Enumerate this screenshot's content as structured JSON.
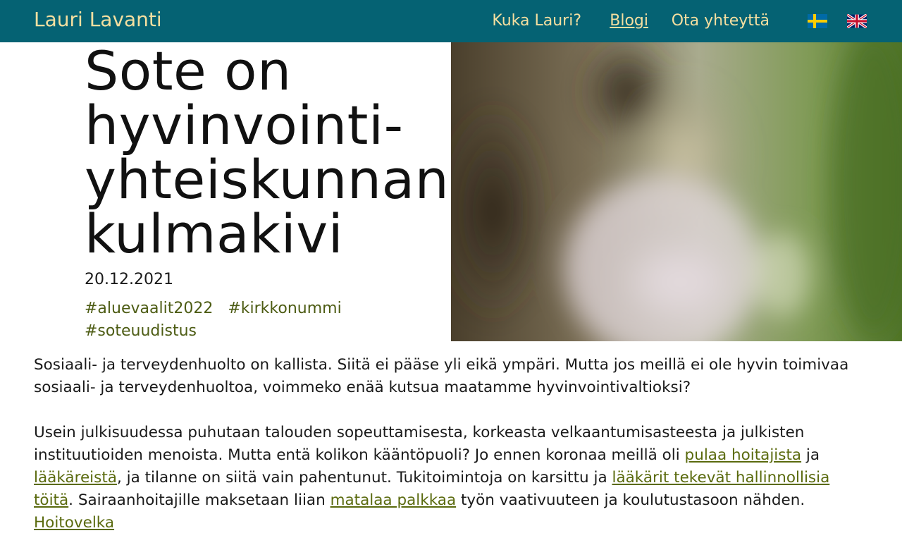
{
  "header": {
    "brand": "Lauri Lavanti",
    "nav": {
      "about": "Kuka Lauri?",
      "blog": "Blogi",
      "contact": "Ota yhteyttä"
    },
    "languages": [
      "swedish-flag-icon",
      "uk-flag-icon"
    ]
  },
  "post": {
    "title_lines": [
      "Sote on",
      "hyvinvointi-",
      "yhteiskunnan",
      "kulmakivi"
    ],
    "date": "20.12.2021",
    "tags": [
      "#aluevaalit2022",
      "#kirkkonummi",
      "#soteuudistus"
    ]
  },
  "article": {
    "p1": "Sosiaali- ja terveydenhuolto on kallista. Siitä ei pääse yli eikä ympäri. Mutta jos meillä ei ole hyvin toimivaa sosiaali- ja terveydenhuoltoa, voimmeko enää kutsua maatamme hyvinvointivaltioksi?",
    "p2": {
      "t1": "Usein julkisuudessa puhutaan talouden sopeuttamisesta, korkeasta velkaantumisasteesta ja julkisten instituutioiden menoista. Mutta entä kolikon kääntöpuoli? Jo ennen koronaa meillä oli ",
      "l1": "pulaa hoitajista",
      "t2": " ja ",
      "l2": "lääkäreistä",
      "t3": ", ja tilanne on siitä vain pahentunut. Tukitoimintoja on karsittu ja ",
      "l3": "lääkärit tekevät hallinnollisia töitä",
      "t4": ". Sairaanhoitajille maksetaan liian ",
      "l4": "matalaa palkkaa",
      "t5": " työn vaativuuteen ja koulutustasoon nähden. ",
      "l5": "Hoitovelka"
    }
  },
  "colors": {
    "header_bg": "#056273",
    "header_text": "#f5dfa0",
    "tag_color": "#4d5c14",
    "link_color": "#5a6a0e"
  }
}
